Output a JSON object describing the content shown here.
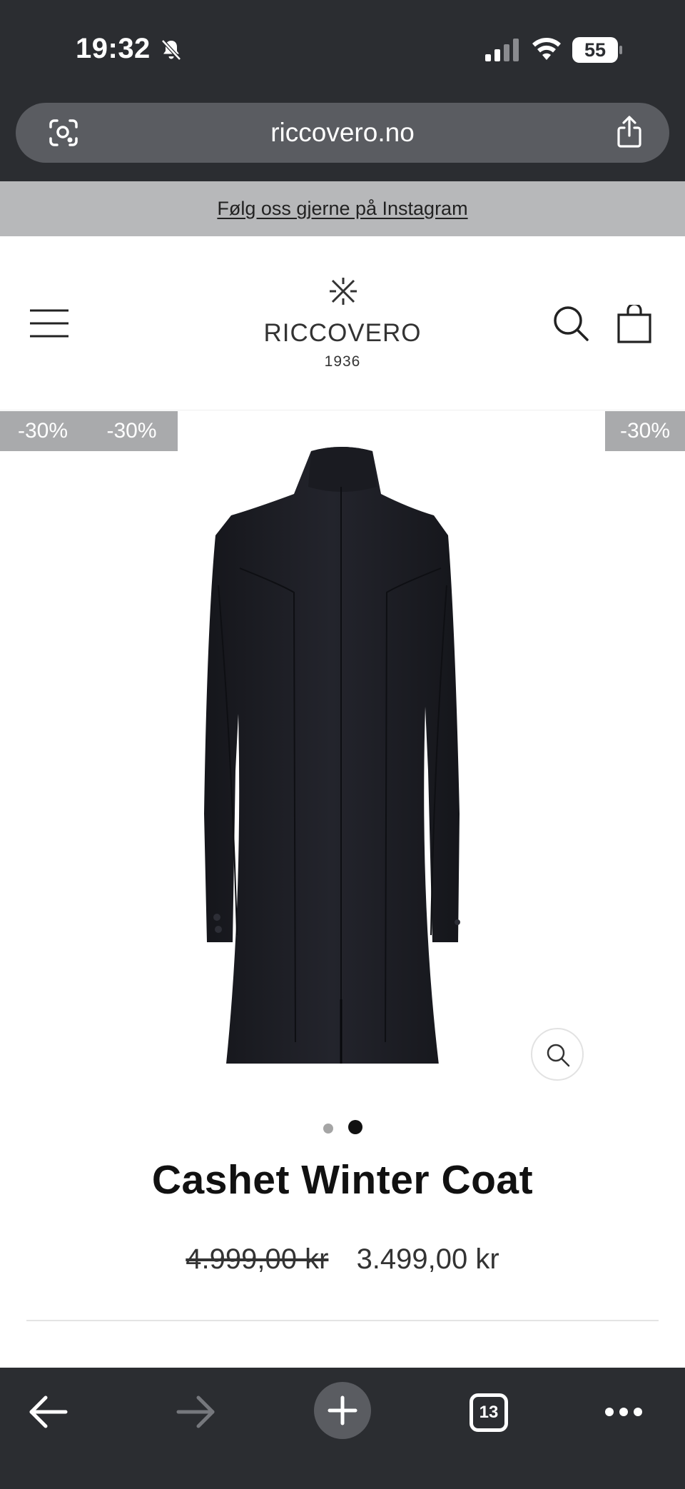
{
  "status_bar": {
    "time": "19:32",
    "battery": "55",
    "icons": [
      "bell-slash-icon",
      "signal-icon",
      "wifi-icon",
      "battery-icon"
    ]
  },
  "browser": {
    "url": "riccovero.no",
    "tab_count": "13",
    "icons": [
      "lens-icon",
      "share-icon",
      "back-arrow-icon",
      "forward-arrow-icon",
      "plus-icon",
      "tabs-icon",
      "more-icon"
    ]
  },
  "announcement": {
    "text": "Følg oss gjerne på Instagram"
  },
  "header": {
    "brand": "RICCOVERO",
    "year": "1936",
    "icons": [
      "menu-icon",
      "search-icon",
      "cart-icon"
    ]
  },
  "product": {
    "badges": [
      "-30%",
      "-30%",
      "-30%"
    ],
    "image_count": 2,
    "active_image": 2,
    "title": "Cashet Winter Coat",
    "price_original": "4.999,00 kr",
    "price_sale": "3.499,00 kr"
  },
  "colors": {
    "chrome": "#2b2d31",
    "urlbar": "#5a5c61",
    "announcement": "#b7b8ba",
    "badge": "#a9aaac",
    "coat": "#1c1d23"
  }
}
